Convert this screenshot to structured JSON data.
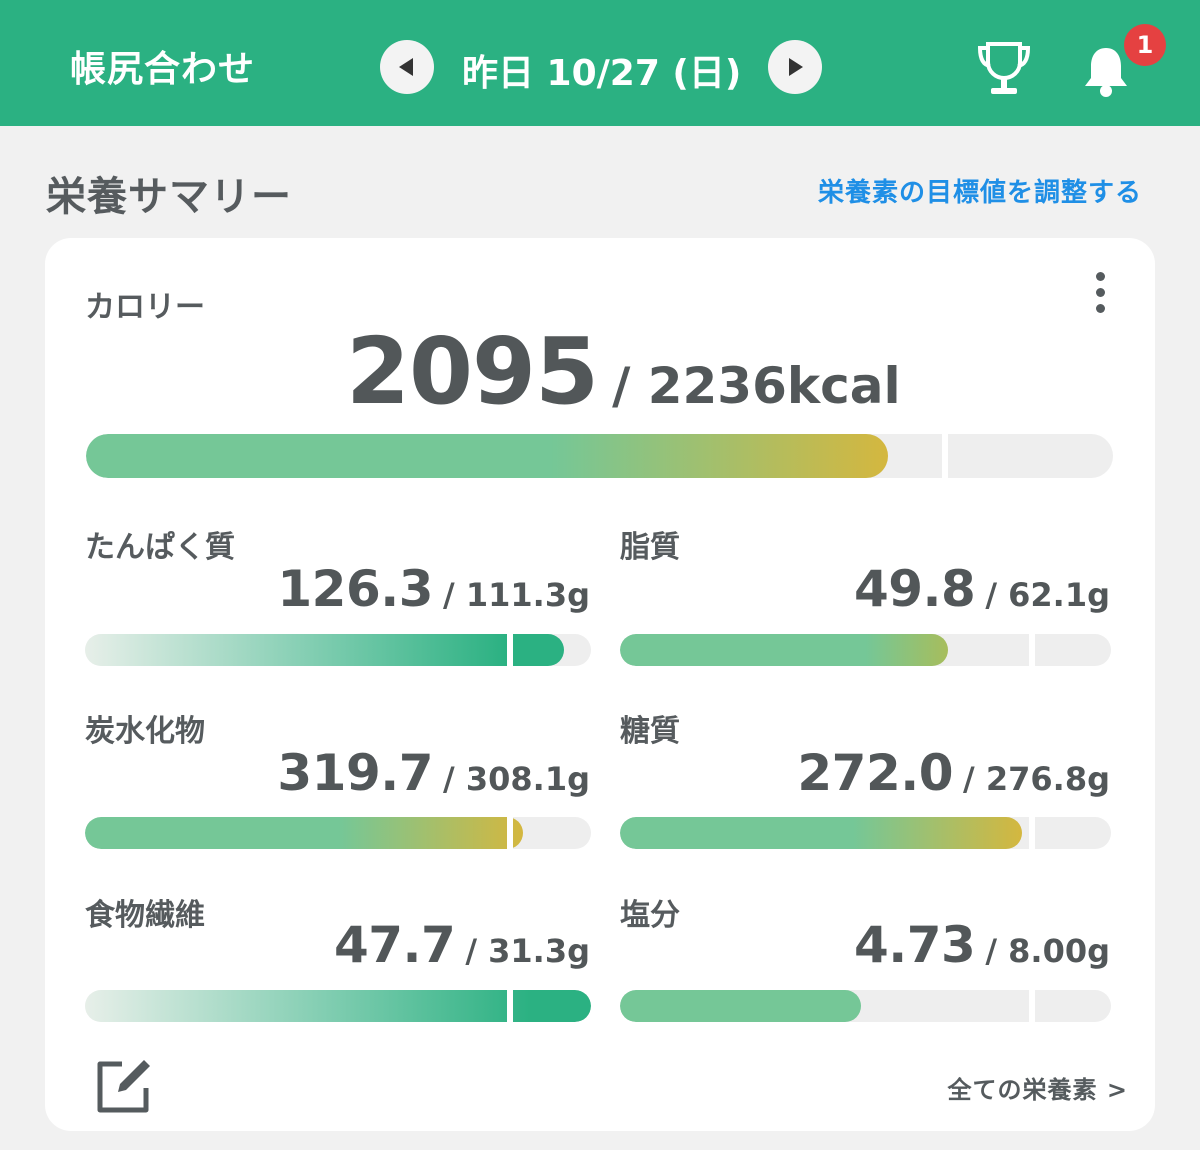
{
  "header": {
    "title": "帳尻合わせ",
    "date": "昨日 10/27 (日)",
    "notification_count": "1",
    "prev_icon": "chevron-left-icon",
    "next_icon": "chevron-right-icon",
    "trophy_icon": "trophy-icon",
    "bell_icon": "bell-icon"
  },
  "section": {
    "title": "栄養サマリー",
    "adjust_link": "栄養素の目標値を調整する"
  },
  "calorie": {
    "label": "カロリー",
    "current": "2095",
    "target": "/ 2236kcal",
    "progress": 0.937
  },
  "nutrients": [
    {
      "key": "protein",
      "label": "たんぱく質",
      "current": "126.3",
      "target": "/ 111.3g",
      "progress": 1.135
    },
    {
      "key": "fat",
      "label": "脂質",
      "current": "49.8",
      "target": "/ 62.1g",
      "progress": 0.802
    },
    {
      "key": "carbs",
      "label": "炭水化物",
      "current": "319.7",
      "target": "/ 308.1g",
      "progress": 1.038
    },
    {
      "key": "sugar",
      "label": "糖質",
      "current": "272.0",
      "target": "/ 276.8g",
      "progress": 0.983
    },
    {
      "key": "fiber",
      "label": "食物繊維",
      "current": "47.7",
      "target": "/ 31.3g",
      "progress": 1.524
    },
    {
      "key": "salt",
      "label": "塩分",
      "current": "4.73",
      "target": "/ 8.00g",
      "progress": 0.591
    }
  ],
  "footer": {
    "edit_icon": "edit-icon",
    "all_nutrients_link": "全ての栄養素 >"
  },
  "colors": {
    "header_bg": "#2bb182",
    "bar_green": "#75c797",
    "bar_yellow": "#d4b73f",
    "bar_over": "#2bb182",
    "badge": "#e54141",
    "link": "#1f8fe6"
  }
}
